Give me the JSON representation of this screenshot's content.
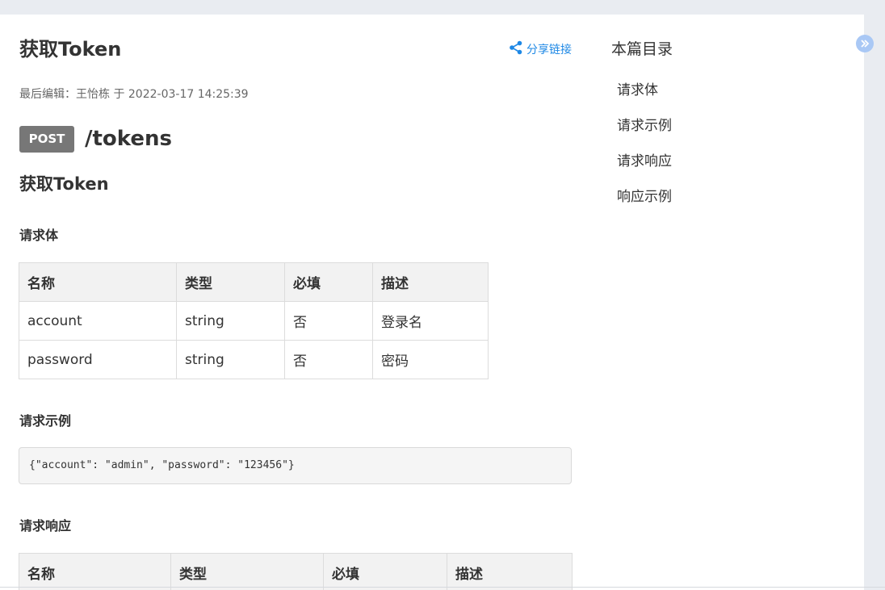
{
  "doc": {
    "title": "获取Token",
    "share_label": "分享链接",
    "meta": "最后编辑：王怡栋 于 2022-03-17 14:25:39"
  },
  "endpoint": {
    "method": "POST",
    "path": "/tokens"
  },
  "section_title": "获取Token",
  "request_body": {
    "heading": "请求体",
    "columns": [
      "名称",
      "类型",
      "必填",
      "描述"
    ],
    "rows": [
      [
        "account",
        "string",
        "否",
        "登录名"
      ],
      [
        "password",
        "string",
        "否",
        "密码"
      ]
    ]
  },
  "request_example": {
    "heading": "请求示例",
    "code": "{\"account\": \"admin\", \"password\": \"123456\"}"
  },
  "response": {
    "heading": "请求响应",
    "columns": [
      "名称",
      "类型",
      "必填",
      "描述"
    ]
  },
  "toc": {
    "title": "本篇目录",
    "items": [
      "请求体",
      "请求示例",
      "请求响应",
      "响应示例"
    ]
  },
  "colors": {
    "accent": "#1e88e5",
    "badge": "#777777",
    "collapse": "#a9c8f5"
  },
  "icons": {
    "share": "share-icon",
    "collapse": "double-chevron-right-icon"
  }
}
